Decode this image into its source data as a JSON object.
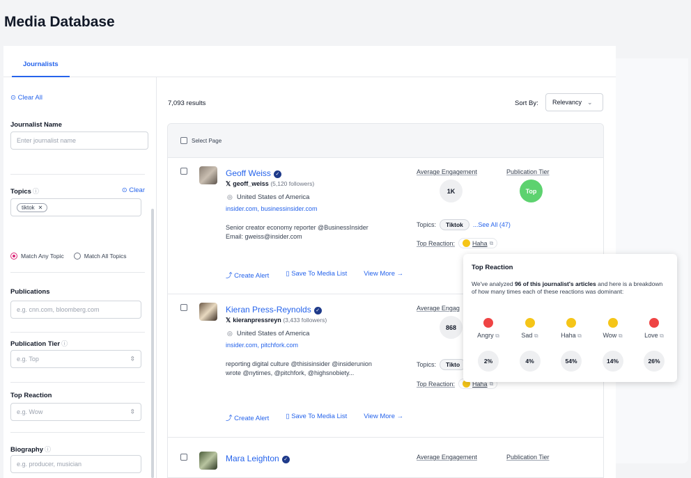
{
  "page": {
    "title": "Media Database"
  },
  "tabs": [
    {
      "label": "Journalists"
    }
  ],
  "sidebar": {
    "clear_all": "Clear All",
    "journalist_name": {
      "label": "Journalist Name",
      "placeholder": "Enter journalist name"
    },
    "topics": {
      "label": "Topics",
      "clear": "Clear",
      "chip": "tiktok",
      "match_any": "Match Any Topic",
      "match_all": "Match All Topics"
    },
    "publications": {
      "label": "Publications",
      "placeholder": "e.g. cnn.com, bloomberg.com"
    },
    "publication_tier": {
      "label": "Publication Tier",
      "placeholder": "e.g. Top"
    },
    "top_reaction": {
      "label": "Top Reaction",
      "placeholder": "e.g. Wow"
    },
    "biography": {
      "label": "Biography",
      "placeholder": "e.g. producer, musician"
    }
  },
  "results": {
    "count": "7,093 results",
    "sort_label": "Sort By:",
    "sort_value": "Relevancy",
    "select_page": "Select Page"
  },
  "labels": {
    "avg_engagement": "Average Engagement",
    "avg_engagement_short": "Average Engag",
    "publication_tier": "Publication Tier",
    "topics": "Topics:",
    "top_reaction": "Top Reaction:",
    "create_alert": "Create Alert",
    "save_to_list": "Save To Media List",
    "view_more": "View More"
  },
  "journalists": [
    {
      "name": "Geoff Weiss",
      "handle": "geoff_weiss",
      "followers": "(5,120 followers)",
      "location": "United States of America",
      "outlets": "insider.com, businessinsider.com",
      "bio_line1": "Senior creator economy reporter @BusinessInsider",
      "bio_line2": "Email: gweiss@insider.com",
      "engagement": "1K",
      "tier": "Top",
      "topic": "Tiktok",
      "see_all": "...See All (47)",
      "reaction": "Haha"
    },
    {
      "name": "Kieran Press-Reynolds",
      "handle": "kieranpressreyn",
      "followers": "(3,433 followers)",
      "location": "United States of America",
      "outlets": "insider.com, pitchfork.com",
      "bio_line1": "reporting digital culture @thisisinsider @insiderunion",
      "bio_line2": "wrote @nytimes, @pitchfork, @highsnobiety...",
      "engagement": "868",
      "topic": "Tikto",
      "reaction": "Haha"
    },
    {
      "name": "Mara Leighton"
    }
  ],
  "tooltip": {
    "title": "Top Reaction",
    "desc_pre": "We've analyzed ",
    "desc_bold": "96 of this journalist's articles",
    "desc_post": " and here is a breakdown of how many times each of these reactions was dominant:",
    "reactions": [
      {
        "name": "Angry",
        "pct": "2%",
        "color": "#ef4444"
      },
      {
        "name": "Sad",
        "pct": "4%",
        "color": "#f5c518"
      },
      {
        "name": "Haha",
        "pct": "54%",
        "color": "#f5c518"
      },
      {
        "name": "Wow",
        "pct": "14%",
        "color": "#f5c518"
      },
      {
        "name": "Love",
        "pct": "26%",
        "color": "#ef4444"
      }
    ]
  }
}
